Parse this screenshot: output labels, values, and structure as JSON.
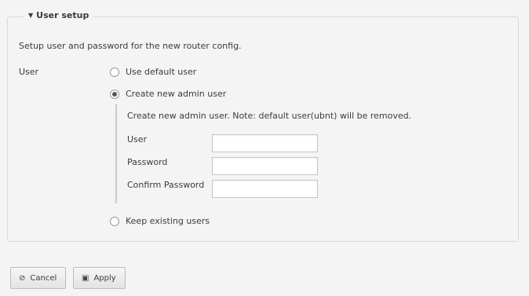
{
  "section": {
    "title": "User setup",
    "description": "Setup user and password for the new router config."
  },
  "user": {
    "label": "User",
    "options": [
      {
        "label": "Use default user",
        "selected": false
      },
      {
        "label": "Create new admin user",
        "selected": true
      },
      {
        "label": "Keep existing users",
        "selected": false
      }
    ],
    "new_admin": {
      "note": "Create new admin user. Note: default user(ubnt) will be removed.",
      "fields": [
        {
          "label": "User",
          "value": ""
        },
        {
          "label": "Password",
          "value": ""
        },
        {
          "label": "Confirm Password",
          "value": ""
        }
      ]
    }
  },
  "buttons": {
    "cancel": "Cancel",
    "cancel_icon": "ban-icon",
    "apply": "Apply",
    "apply_icon": "save-icon"
  }
}
